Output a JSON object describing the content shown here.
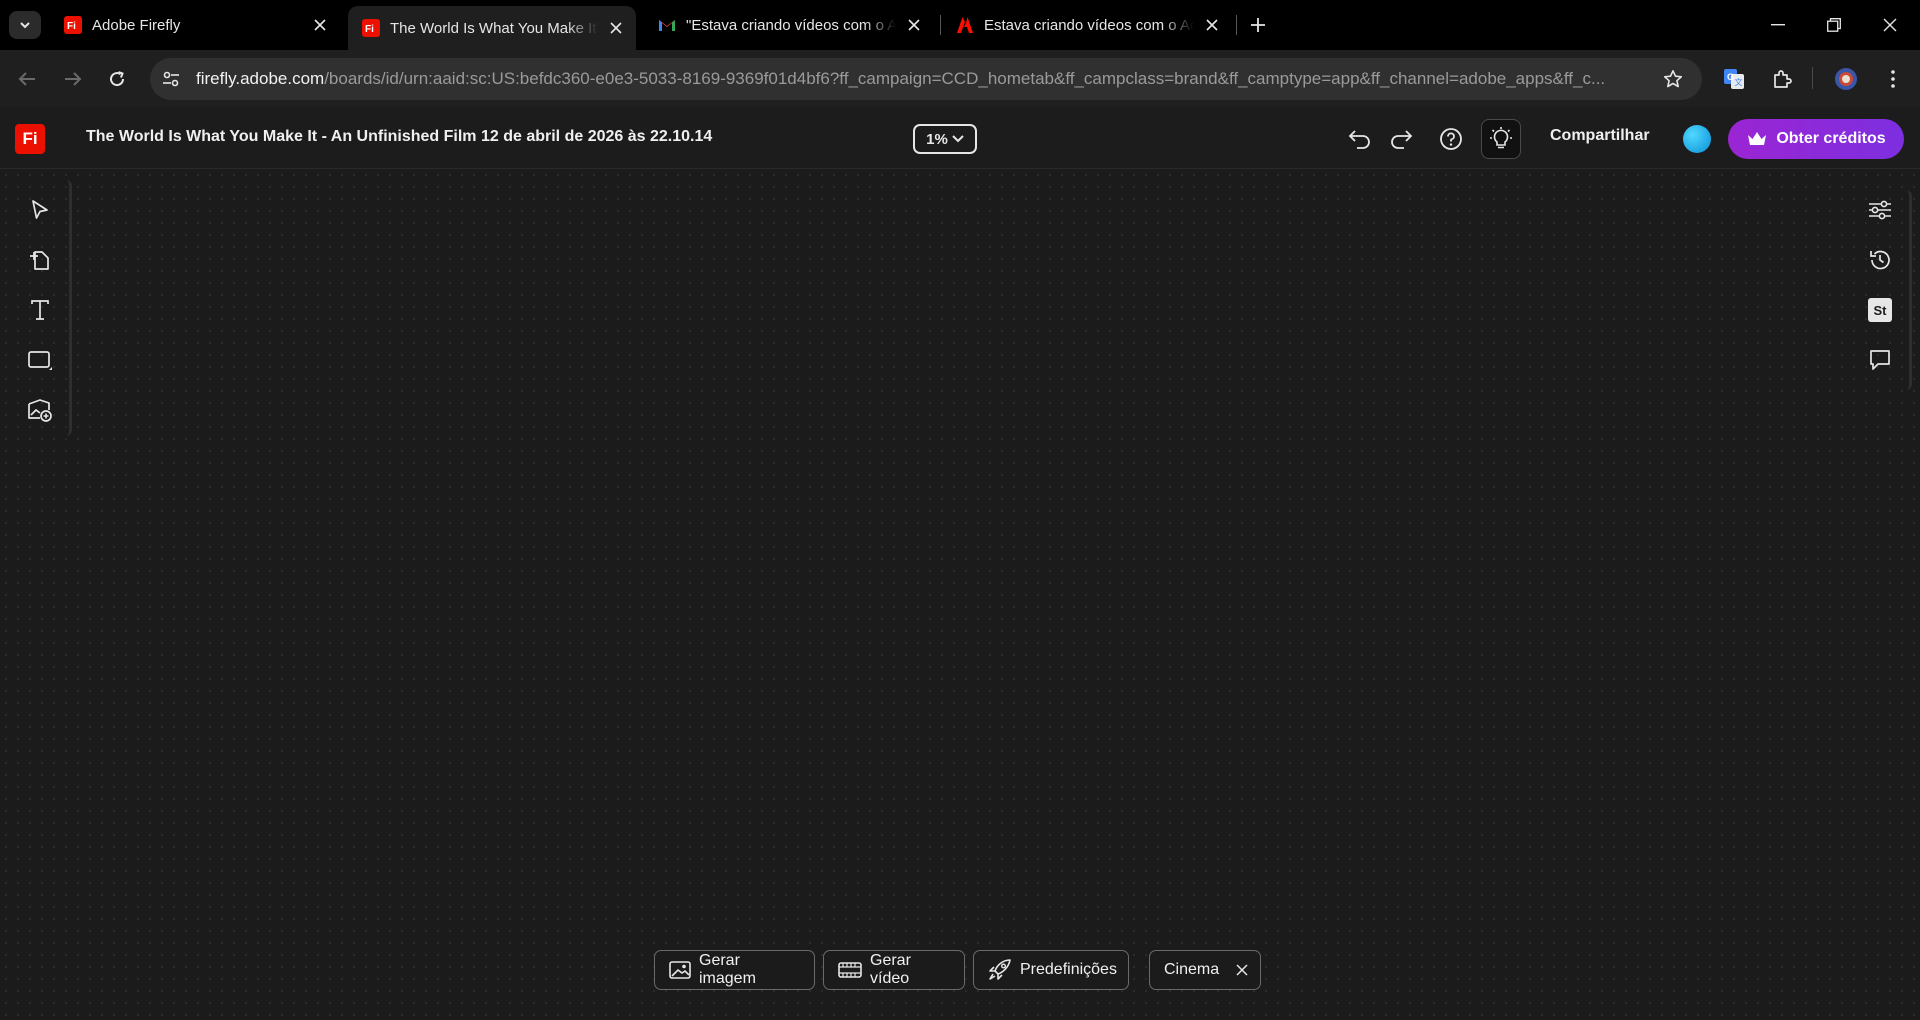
{
  "browser": {
    "tabs": [
      {
        "title": "Adobe Firefly",
        "favicon": "firefly-icon",
        "active": false
      },
      {
        "title": "The World Is What You Make It",
        "favicon": "firefly-icon",
        "active": true
      },
      {
        "title": "\"Estava criando vídeos com o Ad",
        "favicon": "gmail-icon",
        "active": false
      },
      {
        "title": "Estava criando vídeos com o Ad",
        "favicon": "adobe-icon",
        "active": false
      }
    ],
    "url_host": "firefly.adobe.com",
    "url_path": "/boards/id/urn:aaid:sc:US:befdc360-e0e3-5033-8169-9369f01d4bf6?ff_campaign=CCD_hometab&ff_campclass=brand&ff_camptype=app&ff_channel=adobe_apps&ff_c..."
  },
  "app": {
    "logo_text": "Fi",
    "doc_title": "The World Is What You Make It - An Unfinished Film 12 de abril de 2026 às 22.10.14",
    "zoom": "1%",
    "share_label": "Compartilhar",
    "credits_label": "Obter créditos"
  },
  "left_tools": [
    "select-tool",
    "frame-tool",
    "text-tool",
    "shape-tool",
    "add-image-tool"
  ],
  "right_tools": [
    "adjustments",
    "history",
    "stock",
    "comments"
  ],
  "right_tools_stock_label": "St",
  "bottom_bar": {
    "generate_image": "Gerar imagem",
    "generate_video": "Gerar vídeo",
    "presets": "Predefinições",
    "cinema": "Cinema"
  },
  "colors": {
    "accent": "#8a2be2",
    "logo": "#eb1000",
    "background": "#1b1b1b"
  }
}
